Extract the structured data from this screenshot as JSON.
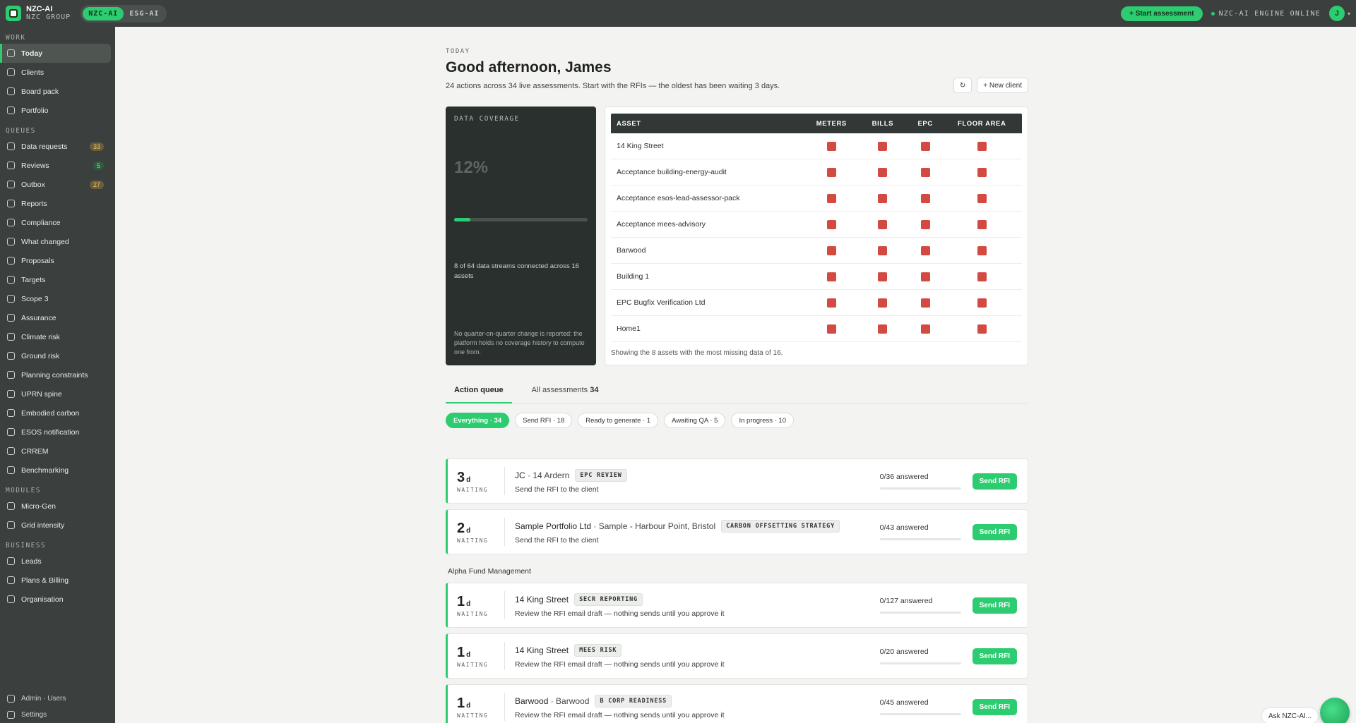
{
  "topbar": {
    "brand_title": "NZC-AI",
    "brand_subtitle": "NZC GROUP",
    "products": [
      "NZC-AI",
      "ESG-AI"
    ],
    "start_button": "+ Start assessment",
    "engine_status": "NZC-AI ENGINE ONLINE",
    "avatar_initial": "J"
  },
  "sidebar": {
    "work_label": "WORK",
    "work": [
      "Today",
      "Clients",
      "Board pack",
      "Portfolio"
    ],
    "queues_label": "QUEUES",
    "queues": [
      {
        "label": "Data requests",
        "badge": "33"
      },
      {
        "label": "Reviews",
        "badge": "5"
      },
      {
        "label": "Outbox",
        "badge": "27"
      },
      {
        "label": "Reports"
      },
      {
        "label": "Compliance"
      },
      {
        "label": "What changed"
      },
      {
        "label": "Proposals"
      },
      {
        "label": "Targets"
      },
      {
        "label": "Scope 3"
      },
      {
        "label": "Assurance"
      },
      {
        "label": "Climate risk"
      },
      {
        "label": "Ground risk"
      },
      {
        "label": "Planning constraints"
      },
      {
        "label": "UPRN spine"
      },
      {
        "label": "Embodied carbon"
      },
      {
        "label": "ESOS notification"
      },
      {
        "label": "CRREM"
      },
      {
        "label": "Benchmarking"
      }
    ],
    "modules_label": "MODULES",
    "modules": [
      "Micro-Gen",
      "Grid intensity"
    ],
    "business_label": "BUSINESS",
    "business": [
      "Leads",
      "Plans & Billing",
      "Organisation"
    ],
    "footer": [
      "Admin · Users",
      "Settings"
    ]
  },
  "header": {
    "eyebrow": "TODAY",
    "greeting": "Good afternoon, James",
    "summary": "24 actions across 34 live assessments. Start with the RFIs — the oldest has been waiting 3 days.",
    "new_client": "+ New client"
  },
  "coverage": {
    "label": "DATA COVERAGE",
    "percent_text": "12%",
    "percent_value": 0.12,
    "detail": "8 of 64 data streams connected across 16 assets",
    "note": "No quarter-on-quarter change is reported: the platform holds no coverage history to compute one from."
  },
  "matrix": {
    "columns": [
      "ASSET",
      "METERS",
      "BILLS",
      "EPC",
      "FLOOR AREA"
    ],
    "rows": [
      "14 King Street",
      "Acceptance building-energy-audit",
      "Acceptance esos-lead-assessor-pack",
      "Acceptance mees-advisory",
      "Barwood",
      "Building 1",
      "EPC Bugfix Verification Ltd",
      "Home1"
    ],
    "footer": "Showing the 8 assets with the most missing data of 16."
  },
  "tabs": {
    "action_queue": "Action queue",
    "all_assessments": "All assessments",
    "all_count": "34"
  },
  "chips": [
    "Everything · 34",
    "Send RFI · 18",
    "Ready to generate · 1",
    "Awaiting QA · 5",
    "In progress · 10"
  ],
  "group_label": "Alpha Fund Management",
  "waiting_label": "WAITING",
  "send_label": "Send RFI",
  "cards": [
    {
      "days": "3",
      "client": "JC",
      "asset": "14 Ardern",
      "tag": "EPC REVIEW",
      "desc": "Send the RFI to the client",
      "progress": "0/36 answered"
    },
    {
      "days": "2",
      "client": "Sample Portfolio Ltd",
      "asset": "Sample - Harbour Point, Bristol",
      "tag": "CARBON OFFSETTING STRATEGY",
      "desc": "Send the RFI to the client",
      "progress": "0/43 answered"
    },
    {
      "days": "1",
      "client": "14 King Street",
      "asset": "",
      "tag": "SECR REPORTING",
      "desc": "Review the RFI email draft — nothing sends until you approve it",
      "progress": "0/127 answered"
    },
    {
      "days": "1",
      "client": "14 King Street",
      "asset": "",
      "tag": "MEES RISK",
      "desc": "Review the RFI email draft — nothing sends until you approve it",
      "progress": "0/20 answered"
    },
    {
      "days": "1",
      "client": "Barwood",
      "asset": "Barwood",
      "tag": "B CORP READINESS",
      "desc": "Review the RFI email draft — nothing sends until you approve it",
      "progress": "0/45 answered"
    }
  ],
  "ask": "Ask NZC-AI...",
  "colors": {
    "accent": "#2ecc71",
    "sidebar": "#3b3f3d",
    "missing": "#d34a42"
  }
}
